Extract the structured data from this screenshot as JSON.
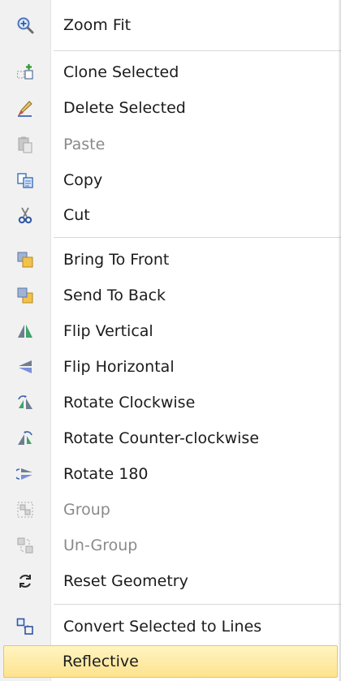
{
  "menu": {
    "items": [
      {
        "label": "Zoom Fit",
        "icon": "zoom-fit-icon"
      },
      {
        "label": "Clone Selected",
        "icon": "clone-icon"
      },
      {
        "label": "Delete Selected",
        "icon": "eraser-icon"
      },
      {
        "label": "Paste",
        "icon": "paste-icon",
        "disabled": true
      },
      {
        "label": "Copy",
        "icon": "copy-icon"
      },
      {
        "label": "Cut",
        "icon": "scissors-icon"
      },
      {
        "label": "Bring To Front",
        "icon": "bring-to-front-icon"
      },
      {
        "label": "Send To Back",
        "icon": "send-to-back-icon"
      },
      {
        "label": "Flip Vertical",
        "icon": "flip-vertical-icon"
      },
      {
        "label": "Flip Horizontal",
        "icon": "flip-horizontal-icon"
      },
      {
        "label": "Rotate Clockwise",
        "icon": "rotate-clockwise-icon"
      },
      {
        "label": "Rotate Counter-clockwise",
        "icon": "rotate-counterclockwise-icon"
      },
      {
        "label": "Rotate 180",
        "icon": "rotate-180-icon"
      },
      {
        "label": "Group",
        "icon": "group-icon",
        "disabled": true
      },
      {
        "label": "Un-Group",
        "icon": "ungroup-icon",
        "disabled": true
      },
      {
        "label": "Reset Geometry",
        "icon": "reset-geometry-icon"
      },
      {
        "label": "Convert Selected to Lines",
        "icon": "convert-to-lines-icon"
      },
      {
        "label": "Reflective",
        "highlighted": true
      }
    ]
  },
  "colors": {
    "gutter": "#f1f1f1",
    "highlight_top": "#fff4c2",
    "highlight_bottom": "#fde38e",
    "disabled_text": "#8a8a8a"
  }
}
